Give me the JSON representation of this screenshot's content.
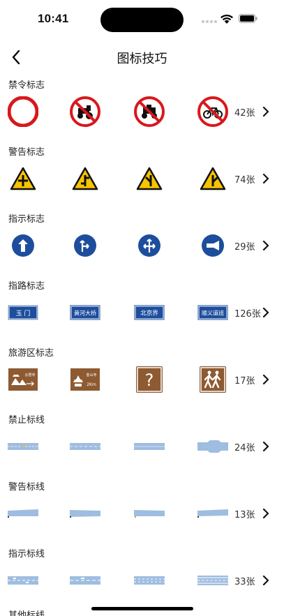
{
  "status": {
    "time": "10:41"
  },
  "nav": {
    "title": "图标技巧"
  },
  "colors": {
    "prohibit_red": "#d7191c",
    "warning_yellow": "#f6c400",
    "indicate_blue": "#1d4e9d",
    "tourist_brown": "#8d5a32",
    "road_blue": "#9fbde0"
  },
  "sections": [
    {
      "title": "禁令标志",
      "count": "42张"
    },
    {
      "title": "警告标志",
      "count": "74张"
    },
    {
      "title": "指示标志",
      "count": "29张"
    },
    {
      "title": "指路标志",
      "count": "126张",
      "signs": [
        "玉 门",
        "黄河大桥",
        "北京界",
        "顺义道班"
      ]
    },
    {
      "title": "旅游区标志",
      "count": "17张",
      "signs": [
        "云居寺",
        "金山寺",
        "2Km",
        "?"
      ]
    },
    {
      "title": "禁止标线",
      "count": "24张"
    },
    {
      "title": "警告标线",
      "count": "13张"
    },
    {
      "title": "指示标线",
      "count": "33张"
    },
    {
      "title": "其他标线"
    }
  ]
}
